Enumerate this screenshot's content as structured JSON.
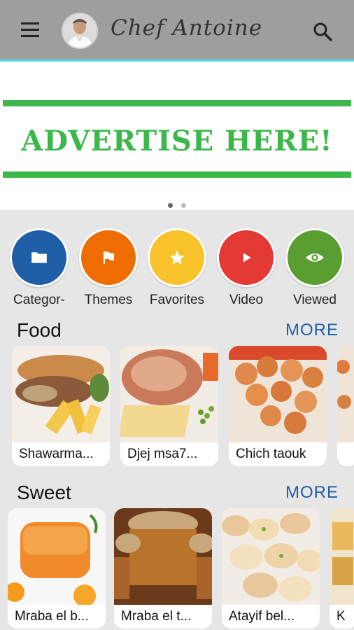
{
  "header": {
    "brand": "Chef Antoine",
    "menu_icon": "menu-icon",
    "search_icon": "search-icon"
  },
  "banner": {
    "text": "ADVERTISE HERE!",
    "accent": "#3cb84a",
    "slides": 2,
    "active_slide": 0
  },
  "shortcuts": [
    {
      "label": "Categor-",
      "icon": "folder-icon",
      "color": "#1f5fa8"
    },
    {
      "label": "Themes",
      "icon": "flag-icon",
      "color": "#ef6c00"
    },
    {
      "label": "Favorites",
      "icon": "star-icon",
      "color": "#f7c22a"
    },
    {
      "label": "Video",
      "icon": "play-icon",
      "color": "#e53935"
    },
    {
      "label": "Viewed",
      "icon": "eye-icon",
      "color": "#5a9e32"
    }
  ],
  "sections": [
    {
      "title": "Food",
      "more": "MORE",
      "items": [
        "Shawarma...",
        "Djej msa7...",
        "Chich taouk"
      ]
    },
    {
      "title": "Sweet",
      "more": "MORE",
      "items": [
        "Mraba el b...",
        "Mraba el t...",
        "Atayif bel...",
        "K"
      ]
    }
  ]
}
